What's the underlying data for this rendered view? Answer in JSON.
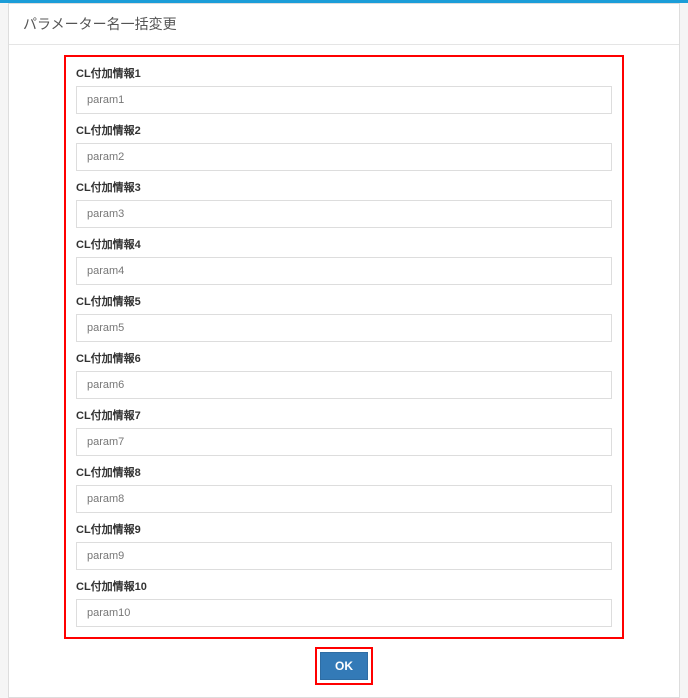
{
  "header": {
    "title": "パラメーター名一括変更"
  },
  "fields": [
    {
      "label": "CL付加情報1",
      "value": "param1"
    },
    {
      "label": "CL付加情報2",
      "value": "param2"
    },
    {
      "label": "CL付加情報3",
      "value": "param3"
    },
    {
      "label": "CL付加情報4",
      "value": "param4"
    },
    {
      "label": "CL付加情報5",
      "value": "param5"
    },
    {
      "label": "CL付加情報6",
      "value": "param6"
    },
    {
      "label": "CL付加情報7",
      "value": "param7"
    },
    {
      "label": "CL付加情報8",
      "value": "param8"
    },
    {
      "label": "CL付加情報9",
      "value": "param9"
    },
    {
      "label": "CL付加情報10",
      "value": "param10"
    }
  ],
  "actions": {
    "ok_label": "OK"
  },
  "colors": {
    "accent": "#1b9dd8",
    "highlight_border": "#ff0000",
    "button_bg": "#337ab7"
  }
}
